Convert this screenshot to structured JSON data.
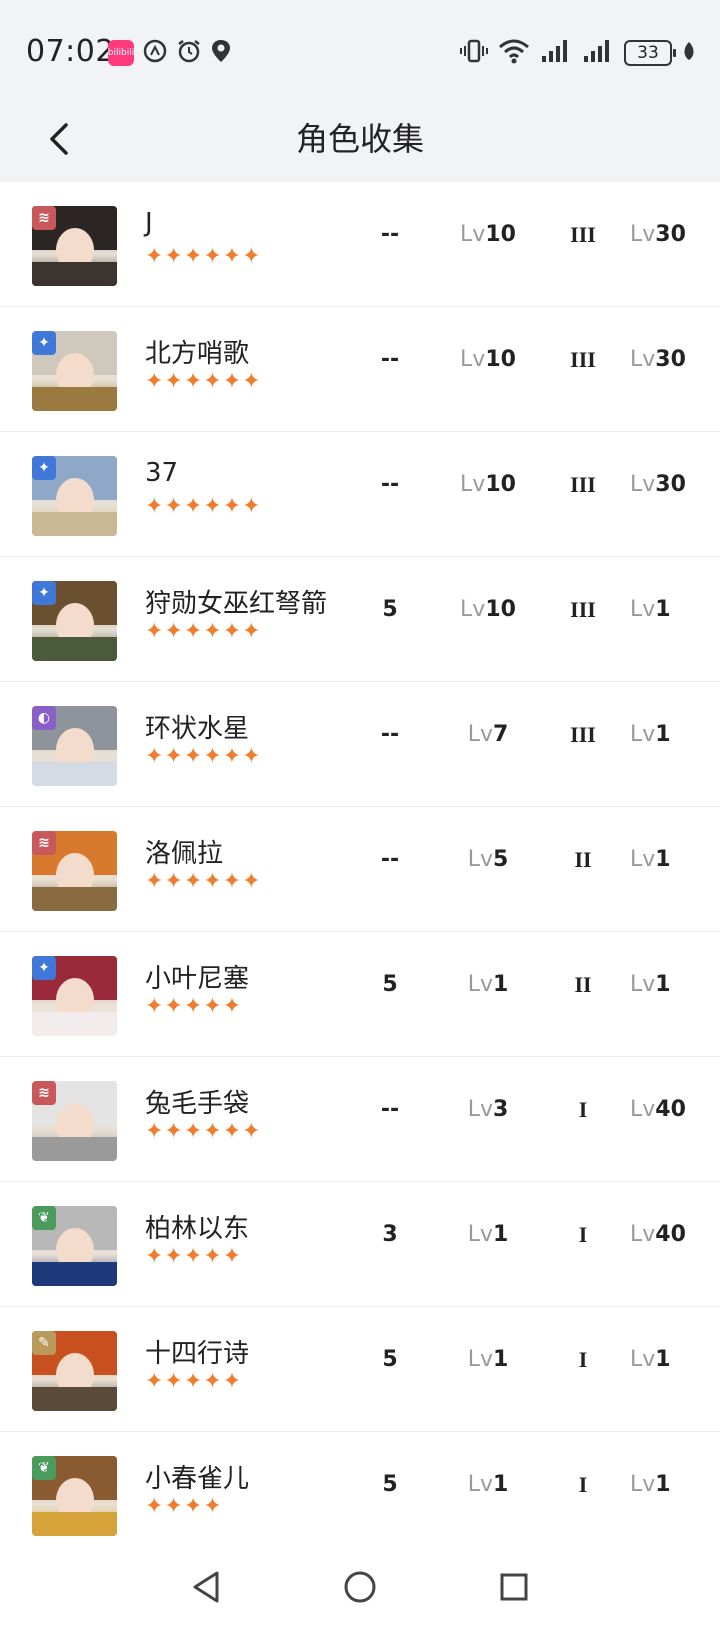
{
  "status": {
    "time": "07:02",
    "app_chip": "bilibili",
    "battery": "33"
  },
  "header": {
    "title": "角色收集"
  },
  "colors": {
    "star": "#f07c2e",
    "badge_red": "#c9585a",
    "badge_blue": "#3f78d8",
    "badge_purple": "#8a5fc7",
    "badge_green": "#4a9b5c",
    "badge_gold": "#b99a5a"
  },
  "characters": [
    {
      "name": "J",
      "stars": "✦✦✦✦✦✦",
      "col_a": "--",
      "lv_prefix": "Lv",
      "lv1": "10",
      "rank": "III",
      "lv2": "30",
      "badge": "red",
      "hair": "#2b2624",
      "body": "#3b3430"
    },
    {
      "name": "北方哨歌",
      "stars": "✦✦✦✦✦✦",
      "col_a": "--",
      "lv_prefix": "Lv",
      "lv1": "10",
      "rank": "III",
      "lv2": "30",
      "badge": "blue",
      "hair": "#cfc9bd",
      "body": "#9a7a3e"
    },
    {
      "name": "37",
      "stars": "✦✦✦✦✦✦",
      "col_a": "--",
      "lv_prefix": "Lv",
      "lv1": "10",
      "rank": "III",
      "lv2": "30",
      "badge": "blue",
      "hair": "#8fa8c8",
      "body": "#c9b894"
    },
    {
      "name": "狩勋女巫红弩箭",
      "stars": "✦✦✦✦✦✦",
      "col_a": "5",
      "lv_prefix": "Lv",
      "lv1": "10",
      "rank": "III",
      "lv2": "1",
      "badge": "blue",
      "hair": "#6a5030",
      "body": "#4a5a3a"
    },
    {
      "name": "环状水星",
      "stars": "✦✦✦✦✦✦",
      "col_a": "--",
      "lv_prefix": "Lv",
      "lv1": "7",
      "rank": "III",
      "lv2": "1",
      "badge": "purple",
      "hair": "#8e949c",
      "body": "#d5dbe2"
    },
    {
      "name": "洛佩拉",
      "stars": "✦✦✦✦✦✦",
      "col_a": "--",
      "lv_prefix": "Lv",
      "lv1": "5",
      "rank": "II",
      "lv2": "1",
      "badge": "red",
      "hair": "#d87a2e",
      "body": "#8a6a40"
    },
    {
      "name": "小叶尼塞",
      "stars": "✦✦✦✦✦",
      "col_a": "5",
      "lv_prefix": "Lv",
      "lv1": "1",
      "rank": "II",
      "lv2": "1",
      "badge": "blue",
      "hair": "#9a2a3a",
      "body": "#f2ecec"
    },
    {
      "name": "兔毛手袋",
      "stars": "✦✦✦✦✦✦",
      "col_a": "--",
      "lv_prefix": "Lv",
      "lv1": "3",
      "rank": "I",
      "lv2": "40",
      "badge": "red",
      "hair": "#e3e3e3",
      "body": "#9a9a9a"
    },
    {
      "name": "柏林以东",
      "stars": "✦✦✦✦✦",
      "col_a": "3",
      "lv_prefix": "Lv",
      "lv1": "1",
      "rank": "I",
      "lv2": "40",
      "badge": "green",
      "hair": "#b8b8b8",
      "body": "#1f3a7a"
    },
    {
      "name": "十四行诗",
      "stars": "✦✦✦✦✦",
      "col_a": "5",
      "lv_prefix": "Lv",
      "lv1": "1",
      "rank": "I",
      "lv2": "1",
      "badge": "gold",
      "hair": "#c8501e",
      "body": "#5a4a3a"
    },
    {
      "name": "小春雀儿",
      "stars": "✦✦✦✦",
      "col_a": "5",
      "lv_prefix": "Lv",
      "lv1": "1",
      "rank": "I",
      "lv2": "1",
      "badge": "green",
      "hair": "#8a5a30",
      "body": "#d6a23a"
    }
  ]
}
